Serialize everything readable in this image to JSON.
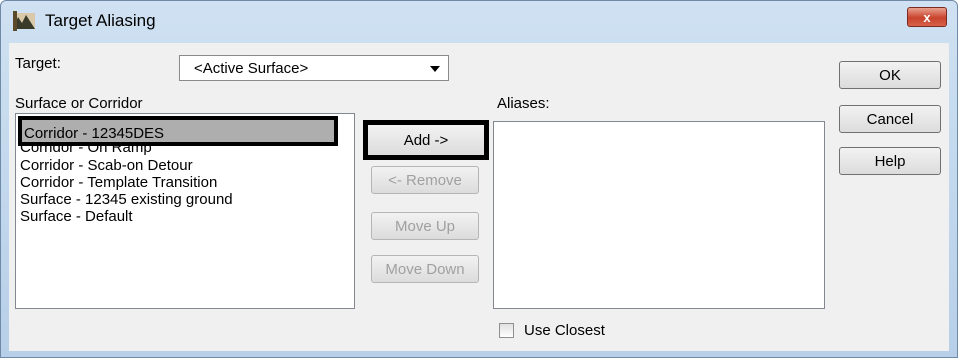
{
  "window": {
    "title": "Target Aliasing",
    "close_glyph": "x"
  },
  "target": {
    "label": "Target:",
    "selected": "<Active Surface>"
  },
  "surface_list": {
    "label": "Surface or Corridor",
    "items": [
      "Corridor - 12345DES",
      "Corridor - On Ramp",
      "Corridor - Scab-on Detour",
      "Corridor - Template Transition",
      "Surface - 12345 existing ground",
      "Surface - Default"
    ],
    "selected_index": 0
  },
  "middle_buttons": {
    "add": "Add ->",
    "remove": "<- Remove",
    "move_up": "Move Up",
    "move_down": "Move Down"
  },
  "aliases": {
    "label": "Aliases:",
    "items": []
  },
  "use_closest": {
    "label": "Use Closest",
    "checked": false
  },
  "dialog_buttons": {
    "ok": "OK",
    "cancel": "Cancel",
    "help": "Help"
  },
  "colors": {
    "title_gradient_top": "#cfe1f2",
    "close_button": "#c8432c",
    "selection": "#aeaeae"
  }
}
